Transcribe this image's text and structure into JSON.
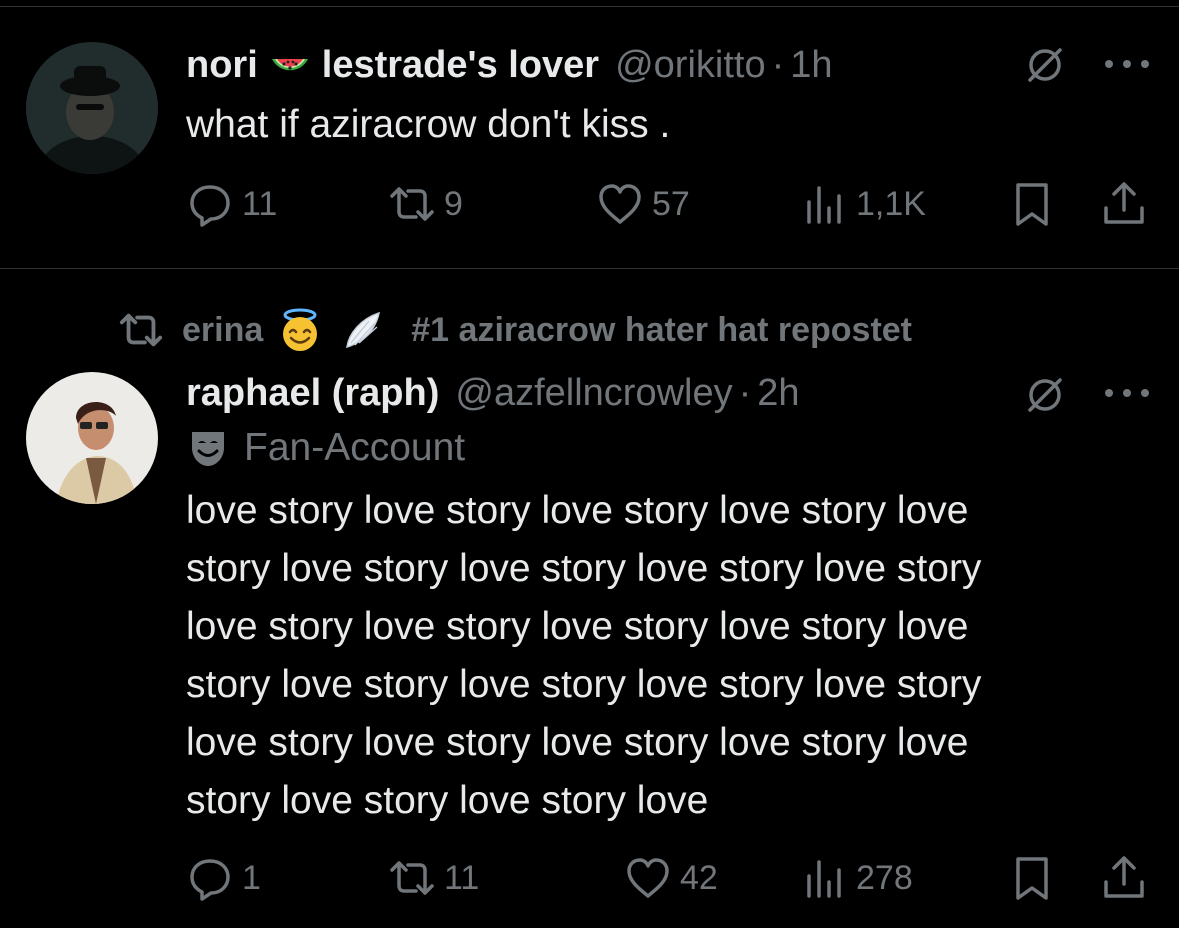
{
  "tweet1": {
    "display_name": "nori",
    "name_emoji": "watermelon-emoji",
    "name_suffix": "lestrade's lover",
    "handle": "@orikitto",
    "separator": "·",
    "time": "1h",
    "text": "what if aziracrow don't kiss .",
    "replies": "11",
    "reposts": "9",
    "likes": "57",
    "views": "1,1K"
  },
  "repost_context": {
    "user": "erina",
    "emojis": [
      "smiling-face-with-halo-emoji",
      "wing-emoji"
    ],
    "label": "#1 aziracrow hater hat repostet"
  },
  "tweet2": {
    "display_name": "raphael (raph)",
    "handle": "@azfellncrowley",
    "separator": "·",
    "time": "2h",
    "account_label": "Fan-Account",
    "text": "love story love story love story love story love\nstory love story love story love story love story\nlove story love story love story love story love\nstory love story love story love story love story\nlove story love story love story love story love\nstory love story love story love",
    "replies": "1",
    "reposts": "11",
    "likes": "42",
    "views": "278"
  },
  "colors": {
    "background": "#000000",
    "text": "#e7e9ea",
    "secondary": "#71767b",
    "divider": "#2f3336"
  }
}
